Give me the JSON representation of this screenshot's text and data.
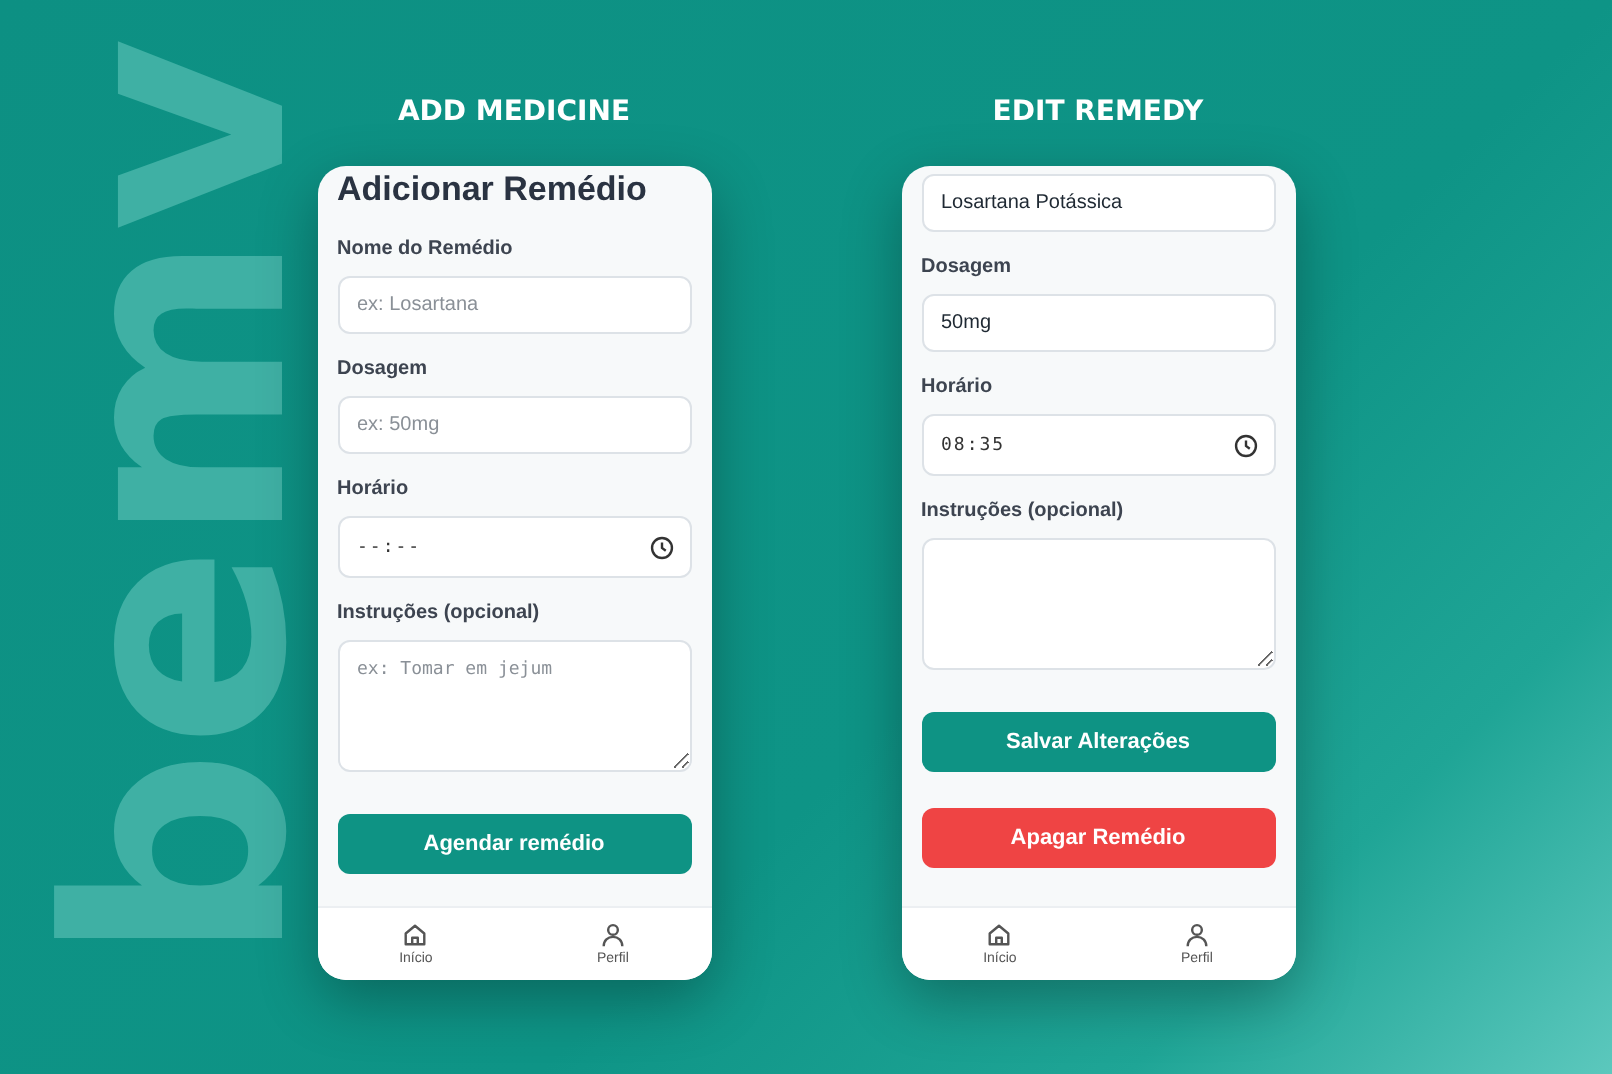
{
  "background": {
    "brand_text": "bemv"
  },
  "screens": [
    {
      "caption": "ADD MEDICINE",
      "heading": "Adicionar Remédio",
      "fields": [
        {
          "kind": "text",
          "label": "Nome do Remédio",
          "placeholder": "ex: Losartana"
        },
        {
          "kind": "text",
          "label": "Dosagem",
          "placeholder": "ex: 50mg"
        },
        {
          "kind": "time",
          "label": "Horário",
          "placeholder": "--:--"
        },
        {
          "kind": "textarea",
          "label": "Instruções (opcional)",
          "placeholder": "ex: Tomar em jejum"
        }
      ],
      "buttons": [
        {
          "kind": "primary",
          "label": "Agendar remédio"
        }
      ],
      "nav": [
        {
          "kind": "home",
          "label": "Início"
        },
        {
          "kind": "profile",
          "label": "Perfil"
        }
      ]
    },
    {
      "caption": "EDIT REMEDY",
      "fields": [
        {
          "kind": "text",
          "value": "Losartana Potássica"
        },
        {
          "kind": "text",
          "label": "Dosagem",
          "value": "50mg"
        },
        {
          "kind": "time",
          "label": "Horário",
          "value": "08:35"
        },
        {
          "kind": "textarea",
          "label": "Instruções (opcional)"
        }
      ],
      "buttons": [
        {
          "kind": "primary",
          "label": "Salvar Alterações"
        },
        {
          "kind": "danger",
          "label": "Apagar Remédio"
        }
      ],
      "nav": [
        {
          "kind": "home",
          "label": "Início"
        },
        {
          "kind": "profile",
          "label": "Perfil"
        }
      ]
    }
  ]
}
